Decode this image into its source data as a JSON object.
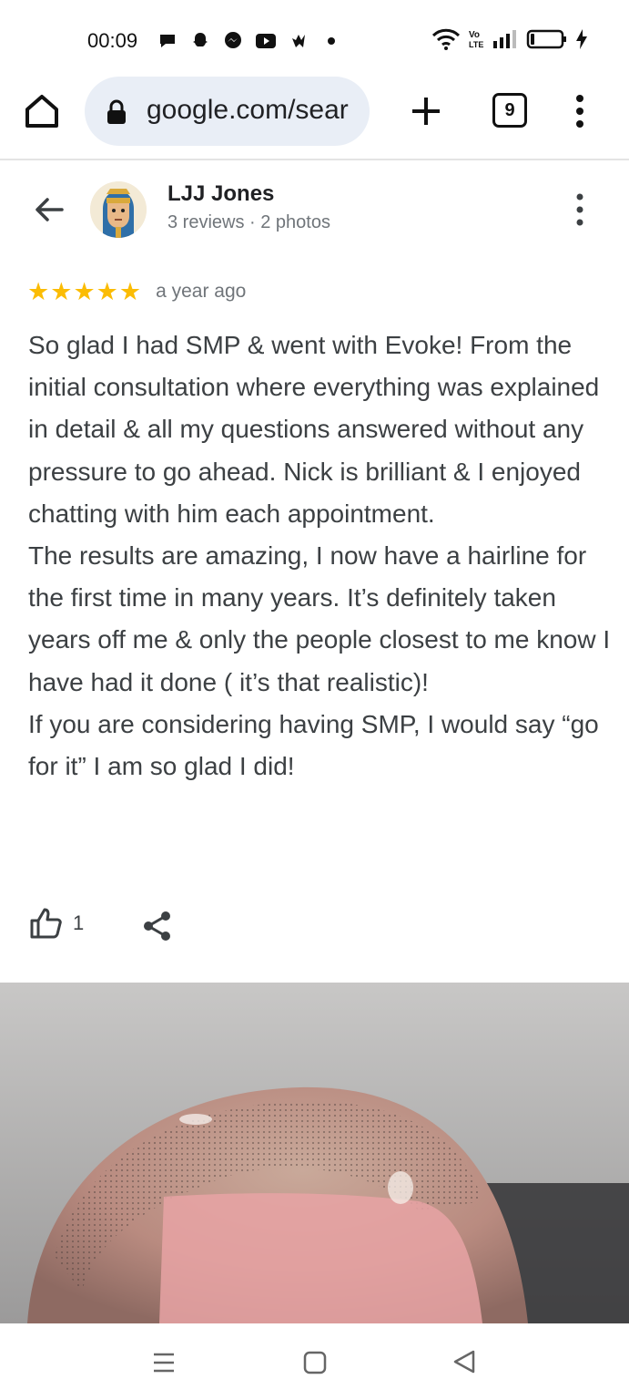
{
  "status_bar": {
    "time": "00:09",
    "left_icons": [
      "chat-bubble-icon",
      "snapchat-icon",
      "messenger-icon",
      "youtube-icon",
      "app-icon",
      "dot-icon"
    ],
    "right_icons": [
      "wifi-icon",
      "volte-icon",
      "signal-icon",
      "battery-icon",
      "charging-icon"
    ]
  },
  "browser": {
    "url": "google.com/sear",
    "tab_count": "9",
    "icons": [
      "home-icon",
      "lock-icon",
      "plus-icon",
      "more-vert-icon"
    ]
  },
  "review": {
    "reviewer_name": "LJJ Jones",
    "reviewer_meta": "3 reviews · 2 photos",
    "rating": 5,
    "time": "a year ago",
    "text": "So glad I had SMP & went with Evoke! From the initial consultation where everything was explained in detail & all my questions answered without any pressure to go ahead. Nick is brilliant & I enjoyed chatting with him each appointment.\nThe results are amazing, I now have a hairline for the first time in many years. It’s definitely taken years off me & only the people closest to me know I have had it done ( it’s that realistic)!\nIf you are considering having SMP, I would say “go for it” I am so glad I did!",
    "like_count": "1"
  },
  "colors": {
    "star": "#fbbc04",
    "url_pill": "#e9eef6",
    "text_primary": "#202124",
    "text_secondary": "#70757a"
  },
  "nav_bar": {
    "icons": [
      "recents-icon",
      "home-square-icon",
      "back-triangle-icon"
    ]
  }
}
